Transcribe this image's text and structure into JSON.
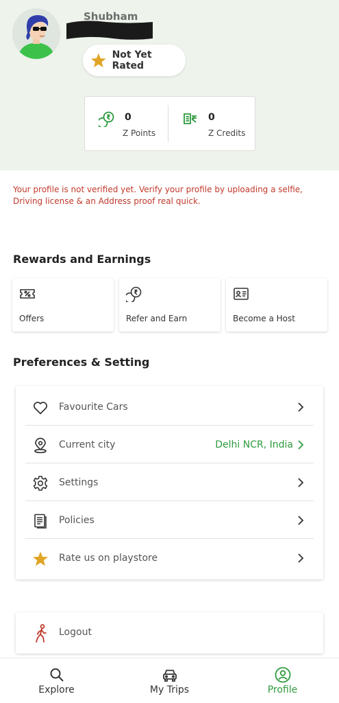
{
  "profile": {
    "name": "Shubham",
    "rating_label": "Not Yet Rated"
  },
  "stats": {
    "points_value": "0",
    "points_label": "Z Points",
    "credits_value": "0",
    "credits_label": "Z Credits"
  },
  "verify_message": "Your profile is not verified yet. Verify your profile by uploading a selfie, Driving license & an Address proof real quick.",
  "rewards": {
    "title": "Rewards and Earnings",
    "items": [
      {
        "label": "Offers",
        "icon": "offer-ticket-icon"
      },
      {
        "label": "Refer and Earn",
        "icon": "rupee-coins-icon"
      },
      {
        "label": "Become a Host",
        "icon": "id-card-icon"
      }
    ]
  },
  "preferences": {
    "title": "Preferences & Setting",
    "items": [
      {
        "label": "Favourite Cars",
        "icon": "heart-icon",
        "value": ""
      },
      {
        "label": "Current city",
        "icon": "location-pin-icon",
        "value": "Delhi NCR, India"
      },
      {
        "label": "Settings",
        "icon": "gear-icon",
        "value": ""
      },
      {
        "label": "Policies",
        "icon": "document-icon",
        "value": ""
      },
      {
        "label": "Rate us on playstore",
        "icon": "star-icon",
        "value": ""
      }
    ]
  },
  "logout": {
    "label": "Logout",
    "icon": "walking-person-icon"
  },
  "nav": {
    "items": [
      {
        "label": "Explore",
        "icon": "search-icon"
      },
      {
        "label": "My Trips",
        "icon": "car-icon"
      },
      {
        "label": "Profile",
        "icon": "profile-icon"
      }
    ],
    "active_index": 2
  },
  "colors": {
    "accent_green": "#2e9b3e",
    "warning_red": "#c0392b",
    "star_gold": "#e0a526",
    "header_bg": "#eef3ec"
  }
}
